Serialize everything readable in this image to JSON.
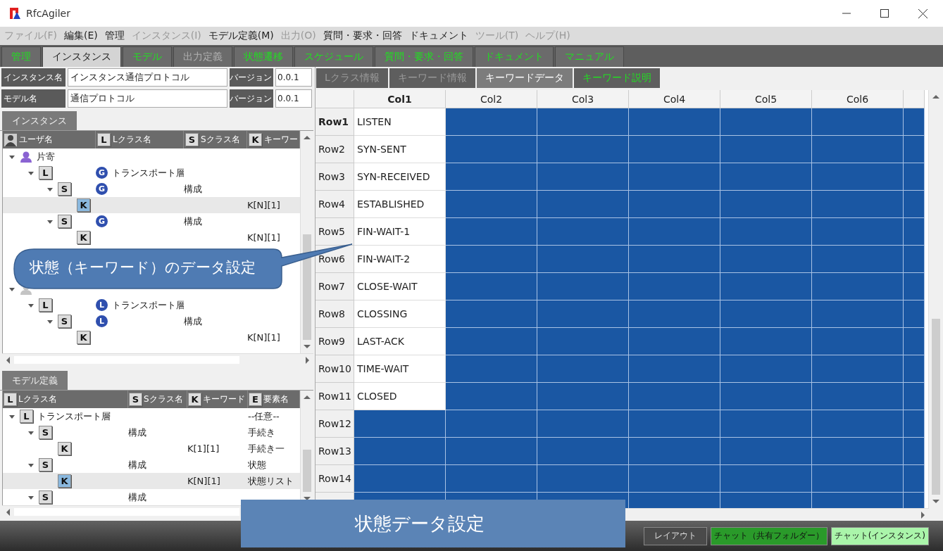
{
  "window": {
    "title": "RfcAgiler"
  },
  "menu": [
    {
      "label": "ファイル(F)",
      "disabled": true
    },
    {
      "label": "編集(E)",
      "disabled": false
    },
    {
      "label": "管理",
      "disabled": false
    },
    {
      "label": "インスタンス(I)",
      "disabled": true
    },
    {
      "label": "モデル定義(M)",
      "disabled": false
    },
    {
      "label": "出力(O)",
      "disabled": true
    },
    {
      "label": "質問・要求・回答",
      "disabled": false
    },
    {
      "label": "ドキュメント",
      "disabled": false
    },
    {
      "label": "ツール(T)",
      "disabled": true
    },
    {
      "label": "ヘルプ(H)",
      "disabled": true
    }
  ],
  "tabs": [
    {
      "label": "管理",
      "selected": false,
      "disabled": false
    },
    {
      "label": "インスタンス",
      "selected": true,
      "disabled": false
    },
    {
      "label": "モデル",
      "selected": false,
      "disabled": false
    },
    {
      "label": "出力定義",
      "selected": false,
      "disabled": true
    },
    {
      "label": "状態遷移",
      "selected": false,
      "disabled": false
    },
    {
      "label": "スケジュール",
      "selected": false,
      "disabled": false
    },
    {
      "label": "質問・要求・回答",
      "selected": false,
      "disabled": false
    },
    {
      "label": "ドキュメント",
      "selected": false,
      "disabled": false
    },
    {
      "label": "マニュアル",
      "selected": false,
      "disabled": false
    }
  ],
  "header_fields": [
    {
      "label": "インスタンス名",
      "value": "インスタンス通信プロトコル",
      "version_label": "バージョン",
      "version": "0.0.1"
    },
    {
      "label": "モデル名",
      "value": "通信プロトコル",
      "version_label": "バージョン",
      "version": "0.0.1"
    }
  ],
  "instance_panel": {
    "tab": "インスタンス",
    "columns": [
      {
        "kind": "user",
        "label": "ユーザ名"
      },
      {
        "kind": "badge",
        "badge": "L",
        "label": "Lクラス名"
      },
      {
        "kind": "badge",
        "badge": "S",
        "label": "Sクラス名"
      },
      {
        "kind": "badge",
        "badge": "K",
        "label": "キーワー"
      }
    ],
    "nodes": [
      {
        "kind": "user",
        "name": "片寄",
        "color": "#8a63d2",
        "expanded": true,
        "selected": false,
        "children": [
          {
            "kind": "class",
            "badge": "L",
            "mark": "G",
            "lclass": "トランスポート層",
            "expanded": true,
            "selected": false,
            "children": [
              {
                "kind": "class",
                "badge": "S",
                "mark": "G",
                "sclass": "構成",
                "expanded": true,
                "selected": false,
                "children": [
                  {
                    "kind": "class",
                    "badge": "K",
                    "keyword": "K[N][1]",
                    "selected": true
                  }
                ]
              },
              {
                "kind": "class",
                "badge": "S",
                "mark": "G",
                "sclass": "構成",
                "expanded": true,
                "selected": false,
                "children": [
                  {
                    "kind": "class",
                    "badge": "K",
                    "keyword": "K[N][1]",
                    "selected": false
                  }
                ]
              }
            ]
          }
        ]
      },
      {
        "kind": "user",
        "color": "#c4c4c4",
        "expanded": true,
        "selected": false,
        "children": [
          {
            "kind": "class",
            "badge": "L",
            "mark": "L",
            "lclass": "トランスポート層",
            "expanded": true,
            "selected": false,
            "children": [
              {
                "kind": "class",
                "badge": "S",
                "mark": "L",
                "sclass": "構成",
                "expanded": true,
                "selected": false,
                "children": [
                  {
                    "kind": "class",
                    "badge": "K",
                    "keyword": "K[N][1]",
                    "selected": false
                  }
                ]
              }
            ]
          }
        ]
      }
    ]
  },
  "model_panel": {
    "tab": "モデル定義",
    "columns": [
      {
        "badge": "L",
        "label": "Lクラス名"
      },
      {
        "badge": "S",
        "label": "Sクラス名"
      },
      {
        "badge": "K",
        "label": "キーワード"
      },
      {
        "badge": "E",
        "label": "要素名"
      }
    ],
    "nodes": [
      {
        "badge": "L",
        "lclass": "トランスポート層",
        "element": "--任意--",
        "expanded": true,
        "selected": false,
        "children": [
          {
            "badge": "S",
            "sclass": "構成",
            "element": "手続き",
            "expanded": true,
            "selected": false,
            "children": [
              {
                "badge": "K",
                "keyword": "K[1][1]",
                "element": "手続き一",
                "selected": false
              }
            ]
          },
          {
            "badge": "S",
            "sclass": "構成",
            "element": "状態",
            "expanded": true,
            "selected": false,
            "children": [
              {
                "badge": "K",
                "keyword": "K[N][1]",
                "element": "状態リスト",
                "selected": true
              }
            ]
          },
          {
            "badge": "S",
            "sclass": "構成",
            "expanded": true,
            "selected": false
          }
        ]
      }
    ]
  },
  "detail_tabs": [
    {
      "label": "Lクラス情報",
      "selected": false,
      "disabled": true
    },
    {
      "label": "キーワード情報",
      "selected": false,
      "disabled": true
    },
    {
      "label": "キーワードデータ",
      "selected": true,
      "disabled": false
    },
    {
      "label": "キーワード説明",
      "selected": false,
      "disabled": false
    }
  ],
  "grid": {
    "columns": [
      {
        "label": "Col1",
        "current": true
      },
      {
        "label": "Col2",
        "current": false
      },
      {
        "label": "Col3",
        "current": false
      },
      {
        "label": "Col4",
        "current": false
      },
      {
        "label": "Col5",
        "current": false
      },
      {
        "label": "Col6",
        "current": false
      }
    ],
    "rows": [
      {
        "label": "Row1",
        "current": true,
        "cells": [
          {
            "text": "LISTEN",
            "selected": false
          },
          {
            "selected": true
          },
          {
            "selected": true
          },
          {
            "selected": true
          },
          {
            "selected": true
          },
          {
            "selected": true
          },
          {
            "selected": true
          }
        ]
      },
      {
        "label": "Row2",
        "current": false,
        "cells": [
          {
            "text": "SYN-SENT",
            "selected": false
          },
          {
            "selected": true
          },
          {
            "selected": true
          },
          {
            "selected": true
          },
          {
            "selected": true
          },
          {
            "selected": true
          },
          {
            "selected": true
          }
        ]
      },
      {
        "label": "Row3",
        "current": false,
        "cells": [
          {
            "text": "SYN-RECEIVED",
            "selected": false
          },
          {
            "selected": true
          },
          {
            "selected": true
          },
          {
            "selected": true
          },
          {
            "selected": true
          },
          {
            "selected": true
          },
          {
            "selected": true
          }
        ]
      },
      {
        "label": "Row4",
        "current": false,
        "cells": [
          {
            "text": "ESTABLISHED",
            "selected": false
          },
          {
            "selected": true
          },
          {
            "selected": true
          },
          {
            "selected": true
          },
          {
            "selected": true
          },
          {
            "selected": true
          },
          {
            "selected": true
          }
        ]
      },
      {
        "label": "Row5",
        "current": false,
        "cells": [
          {
            "text": "FIN-WAIT-1",
            "selected": false
          },
          {
            "selected": true
          },
          {
            "selected": true
          },
          {
            "selected": true
          },
          {
            "selected": true
          },
          {
            "selected": true
          },
          {
            "selected": true
          }
        ]
      },
      {
        "label": "Row6",
        "current": false,
        "cells": [
          {
            "text": "FIN-WAIT-2",
            "selected": false
          },
          {
            "selected": true
          },
          {
            "selected": true
          },
          {
            "selected": true
          },
          {
            "selected": true
          },
          {
            "selected": true
          },
          {
            "selected": true
          }
        ]
      },
      {
        "label": "Row7",
        "current": false,
        "cells": [
          {
            "text": "CLOSE-WAIT",
            "selected": false
          },
          {
            "selected": true
          },
          {
            "selected": true
          },
          {
            "selected": true
          },
          {
            "selected": true
          },
          {
            "selected": true
          },
          {
            "selected": true
          }
        ]
      },
      {
        "label": "Row8",
        "current": false,
        "cells": [
          {
            "text": "CLOSSING",
            "selected": false
          },
          {
            "selected": true
          },
          {
            "selected": true
          },
          {
            "selected": true
          },
          {
            "selected": true
          },
          {
            "selected": true
          },
          {
            "selected": true
          }
        ]
      },
      {
        "label": "Row9",
        "current": false,
        "cells": [
          {
            "text": "LAST-ACK",
            "selected": false
          },
          {
            "selected": true
          },
          {
            "selected": true
          },
          {
            "selected": true
          },
          {
            "selected": true
          },
          {
            "selected": true
          },
          {
            "selected": true
          }
        ]
      },
      {
        "label": "Row10",
        "current": false,
        "cells": [
          {
            "text": "TIME-WAIT",
            "selected": false
          },
          {
            "selected": true
          },
          {
            "selected": true
          },
          {
            "selected": true
          },
          {
            "selected": true
          },
          {
            "selected": true
          },
          {
            "selected": true
          }
        ]
      },
      {
        "label": "Row11",
        "current": false,
        "cells": [
          {
            "text": "CLOSED",
            "selected": false
          },
          {
            "selected": true
          },
          {
            "selected": true
          },
          {
            "selected": true
          },
          {
            "selected": true
          },
          {
            "selected": true
          },
          {
            "selected": true
          }
        ]
      },
      {
        "label": "Row12",
        "current": false,
        "cells": [
          {
            "selected": true
          },
          {
            "selected": true
          },
          {
            "selected": true
          },
          {
            "selected": true
          },
          {
            "selected": true
          },
          {
            "selected": true
          },
          {
            "selected": true
          }
        ]
      },
      {
        "label": "Row13",
        "current": false,
        "cells": [
          {
            "selected": true
          },
          {
            "selected": true
          },
          {
            "selected": true
          },
          {
            "selected": true
          },
          {
            "selected": true
          },
          {
            "selected": true
          },
          {
            "selected": true
          }
        ]
      },
      {
        "label": "Row14",
        "current": false,
        "cells": [
          {
            "selected": true
          },
          {
            "selected": true
          },
          {
            "selected": true
          },
          {
            "selected": true
          },
          {
            "selected": true
          },
          {
            "selected": true
          },
          {
            "selected": true
          }
        ]
      },
      {
        "current": false,
        "cells": [
          {
            "selected": true
          },
          {
            "selected": true
          },
          {
            "selected": true
          },
          {
            "selected": true
          },
          {
            "selected": true
          },
          {
            "selected": true
          },
          {
            "selected": true
          }
        ]
      }
    ]
  },
  "status_buttons": [
    {
      "label": "レイアウト",
      "kind": "plain"
    },
    {
      "label": "チャット（共有フォルダー）",
      "kind": "active"
    },
    {
      "label": "チャット(インスタンス)",
      "kind": "light"
    }
  ],
  "annotations": [
    {
      "kind": "callout",
      "text": "状態（キーワード）のデータ設定"
    },
    {
      "kind": "banner",
      "text": "状態データ設定"
    }
  ]
}
